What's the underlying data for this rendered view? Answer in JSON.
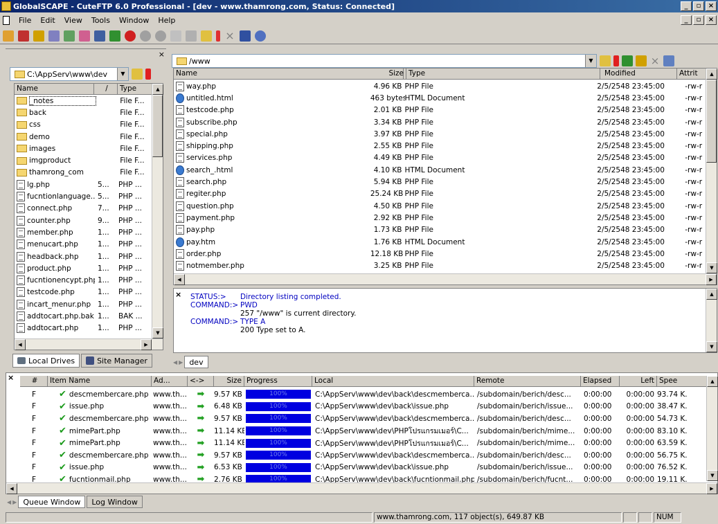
{
  "window": {
    "title": "GlobalSCAPE - CuteFTP 6.0 Professional - [dev - www.thamrong.com, Status: Connected]"
  },
  "menu": [
    "File",
    "Edit",
    "View",
    "Tools",
    "Window",
    "Help"
  ],
  "local": {
    "path": "C:\\AppServ\\www\\dev",
    "headers": [
      "Name",
      "/",
      "Type"
    ],
    "rows": [
      {
        "name": "_notes",
        "size": "",
        "type": "File F...",
        "icon": "folder"
      },
      {
        "name": "back",
        "size": "",
        "type": "File F...",
        "icon": "folder"
      },
      {
        "name": "css",
        "size": "",
        "type": "File F...",
        "icon": "folder"
      },
      {
        "name": "demo",
        "size": "",
        "type": "File F...",
        "icon": "folder"
      },
      {
        "name": "images",
        "size": "",
        "type": "File F...",
        "icon": "folder"
      },
      {
        "name": "imgproduct",
        "size": "",
        "type": "File F...",
        "icon": "folder"
      },
      {
        "name": "thamrong_com",
        "size": "",
        "type": "File F...",
        "icon": "folder"
      },
      {
        "name": "lg.php",
        "size": "5...",
        "type": "PHP ...",
        "icon": "file"
      },
      {
        "name": "fucntionlanguage...",
        "size": "5...",
        "type": "PHP ...",
        "icon": "file"
      },
      {
        "name": "connect.php",
        "size": "7...",
        "type": "PHP ...",
        "icon": "file"
      },
      {
        "name": "counter.php",
        "size": "9...",
        "type": "PHP ...",
        "icon": "file"
      },
      {
        "name": "member.php",
        "size": "1...",
        "type": "PHP ...",
        "icon": "file"
      },
      {
        "name": "menucart.php",
        "size": "1...",
        "type": "PHP ...",
        "icon": "file"
      },
      {
        "name": "headback.php",
        "size": "1...",
        "type": "PHP ...",
        "icon": "file"
      },
      {
        "name": "product.php",
        "size": "1...",
        "type": "PHP ...",
        "icon": "file"
      },
      {
        "name": "fucntionencypt.php",
        "size": "1...",
        "type": "PHP ...",
        "icon": "file"
      },
      {
        "name": "testcode.php",
        "size": "1...",
        "type": "PHP ...",
        "icon": "file"
      },
      {
        "name": "incart_menur.php",
        "size": "1...",
        "type": "PHP ...",
        "icon": "file"
      },
      {
        "name": "addtocart.php.bak",
        "size": "1...",
        "type": "BAK ...",
        "icon": "file"
      },
      {
        "name": "addtocart.php",
        "size": "1...",
        "type": "PHP ...",
        "icon": "file"
      }
    ],
    "tabs": [
      "Local Drives",
      "Site Manager"
    ]
  },
  "remote": {
    "path": "/www",
    "headers": [
      "Name",
      "Size",
      "Type",
      "Modified",
      "Attrit"
    ],
    "rows": [
      {
        "name": "way.php",
        "size": "4.96 KB",
        "type": "PHP File",
        "modified": "2/5/2548 23:45:00",
        "attr": "-rw-r",
        "icon": "file"
      },
      {
        "name": "untitled.html",
        "size": "463 bytes",
        "type": "HTML Document",
        "modified": "2/5/2548 23:45:00",
        "attr": "-rw-r",
        "icon": "html"
      },
      {
        "name": "testcode.php",
        "size": "2.01 KB",
        "type": "PHP File",
        "modified": "2/5/2548 23:45:00",
        "attr": "-rw-r",
        "icon": "file"
      },
      {
        "name": "subscribe.php",
        "size": "3.34 KB",
        "type": "PHP File",
        "modified": "2/5/2548 23:45:00",
        "attr": "-rw-r",
        "icon": "file"
      },
      {
        "name": "special.php",
        "size": "3.97 KB",
        "type": "PHP File",
        "modified": "2/5/2548 23:45:00",
        "attr": "-rw-r",
        "icon": "file"
      },
      {
        "name": "shipping.php",
        "size": "2.55 KB",
        "type": "PHP File",
        "modified": "2/5/2548 23:45:00",
        "attr": "-rw-r",
        "icon": "file"
      },
      {
        "name": "services.php",
        "size": "4.49 KB",
        "type": "PHP File",
        "modified": "2/5/2548 23:45:00",
        "attr": "-rw-r",
        "icon": "file"
      },
      {
        "name": "search_.html",
        "size": "4.10 KB",
        "type": "HTML Document",
        "modified": "2/5/2548 23:45:00",
        "attr": "-rw-r",
        "icon": "html"
      },
      {
        "name": "search.php",
        "size": "5.94 KB",
        "type": "PHP File",
        "modified": "2/5/2548 23:45:00",
        "attr": "-rw-r",
        "icon": "file"
      },
      {
        "name": "regiter.php",
        "size": "25.24 KB",
        "type": "PHP File",
        "modified": "2/5/2548 23:45:00",
        "attr": "-rw-r",
        "icon": "file"
      },
      {
        "name": "question.php",
        "size": "4.50 KB",
        "type": "PHP File",
        "modified": "2/5/2548 23:45:00",
        "attr": "-rw-r",
        "icon": "file"
      },
      {
        "name": "payment.php",
        "size": "2.92 KB",
        "type": "PHP File",
        "modified": "2/5/2548 23:45:00",
        "attr": "-rw-r",
        "icon": "file"
      },
      {
        "name": "pay.php",
        "size": "1.73 KB",
        "type": "PHP File",
        "modified": "2/5/2548 23:45:00",
        "attr": "-rw-r",
        "icon": "file"
      },
      {
        "name": "pay.htm",
        "size": "1.76 KB",
        "type": "HTML Document",
        "modified": "2/5/2548 23:45:00",
        "attr": "-rw-r",
        "icon": "html"
      },
      {
        "name": "order.php",
        "size": "12.18 KB",
        "type": "PHP File",
        "modified": "2/5/2548 23:45:00",
        "attr": "-rw-r",
        "icon": "file"
      },
      {
        "name": "notmember.php",
        "size": "3.25 KB",
        "type": "PHP File",
        "modified": "2/5/2548 23:45:00",
        "attr": "-rw-r",
        "icon": "file"
      }
    ],
    "tab": "dev"
  },
  "log": [
    {
      "key": "STATUS:>",
      "val": "Directory listing completed.",
      "extra": ""
    },
    {
      "key": "COMMAND:>",
      "val": "PWD",
      "extra": "257 \"/www\" is current directory."
    },
    {
      "key": "COMMAND:>",
      "val": "TYPE A",
      "extra": "200 Type set to A."
    }
  ],
  "queue": {
    "headers": [
      "#",
      "Item Name",
      "Ad...",
      "<->",
      "Size",
      "Progress",
      "Local",
      "Remote",
      "Elapsed",
      "Left",
      "Spee"
    ],
    "progress_label": "100%",
    "rows": [
      {
        "type": "F",
        "name": "descmembercare.php",
        "addr": "www.th...",
        "size": "9.57 KB",
        "local": "C:\\AppServ\\www\\dev\\back\\descmemberca...",
        "remote": "/subdomain/berich/desc...",
        "elapsed": "0:00:00",
        "left": "0:00:00",
        "speed": "93.74 K."
      },
      {
        "type": "F",
        "name": "issue.php",
        "addr": "www.th...",
        "size": "6.48 KB",
        "local": "C:\\AppServ\\www\\dev\\back\\issue.php",
        "remote": "/subdomain/berich/issue...",
        "elapsed": "0:00:00",
        "left": "0:00:00",
        "speed": "38.47 K."
      },
      {
        "type": "F",
        "name": "descmembercare.php",
        "addr": "www.th...",
        "size": "9.57 KB",
        "local": "C:\\AppServ\\www\\dev\\back\\descmemberca...",
        "remote": "/subdomain/berich/desc...",
        "elapsed": "0:00:00",
        "left": "0:00:00",
        "speed": "54.73 K."
      },
      {
        "type": "F",
        "name": "mimePart.php",
        "addr": "www.th...",
        "size": "11.14 KB",
        "local": "C:\\AppServ\\www\\dev\\PHPโปรแกรมเมอร์\\C...",
        "remote": "/subdomain/berich/mime...",
        "elapsed": "0:00:00",
        "left": "0:00:00",
        "speed": "83.10 K."
      },
      {
        "type": "F",
        "name": "mimePart.php",
        "addr": "www.th...",
        "size": "11.14 KB",
        "local": "C:\\AppServ\\www\\dev\\PHPโปรแกรมเมอร์\\C...",
        "remote": "/subdomain/berich/mime...",
        "elapsed": "0:00:00",
        "left": "0:00:00",
        "speed": "63.59 K."
      },
      {
        "type": "F",
        "name": "descmembercare.php",
        "addr": "www.th...",
        "size": "9.57 KB",
        "local": "C:\\AppServ\\www\\dev\\back\\descmemberca...",
        "remote": "/subdomain/berich/desc...",
        "elapsed": "0:00:00",
        "left": "0:00:00",
        "speed": "56.75 K."
      },
      {
        "type": "F",
        "name": "issue.php",
        "addr": "www.th...",
        "size": "6.53 KB",
        "local": "C:\\AppServ\\www\\dev\\back\\issue.php",
        "remote": "/subdomain/berich/issue...",
        "elapsed": "0:00:00",
        "left": "0:00:00",
        "speed": "76.52 K."
      },
      {
        "type": "F",
        "name": "fucntionmail.php",
        "addr": "www.th...",
        "size": "2.76 KB",
        "local": "C:\\AppServ\\www\\dev\\back\\fucntionmail.php",
        "remote": "/subdomain/berich/fucnt...",
        "elapsed": "0:00:00",
        "left": "0:00:00",
        "speed": "19.11 K."
      }
    ],
    "tabs": [
      "Queue Window",
      "Log Window"
    ]
  },
  "status": {
    "text": "www.thamrong.com, 117 object(s), 649.87 KB",
    "num": "NUM"
  }
}
